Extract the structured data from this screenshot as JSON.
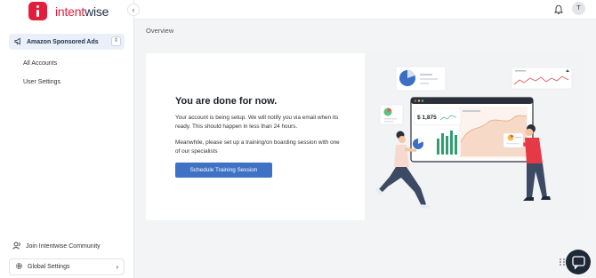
{
  "brand": {
    "name_prefix": "intent",
    "name_suffix": "wise",
    "accent": "#e31e3c"
  },
  "sidebar": {
    "collapse_icon": "chevron-left-icon",
    "selector": {
      "label": "Amazon Sponsored Ads",
      "icon": "megaphone-icon"
    },
    "items": [
      {
        "label": "All Accounts"
      },
      {
        "label": "User Settings"
      }
    ],
    "community_label": "Join Intentwise Community",
    "global_settings_label": "Global Settings"
  },
  "header": {
    "avatar_initial": "T",
    "bell_icon": "bell-icon"
  },
  "breadcrumb": "Overview",
  "card": {
    "title": "You are done for now.",
    "message1": "Your account is being setup. We will notify you via email when its ready. This should happen in less than 24 hours.",
    "message2": "Meanwhile, please set up a training/on boarding session with one of our specialists",
    "cta_label": "Schedule Training Session",
    "cta_color": "#3f72c4",
    "illustration": {
      "price_label": "$ 1,875"
    }
  }
}
